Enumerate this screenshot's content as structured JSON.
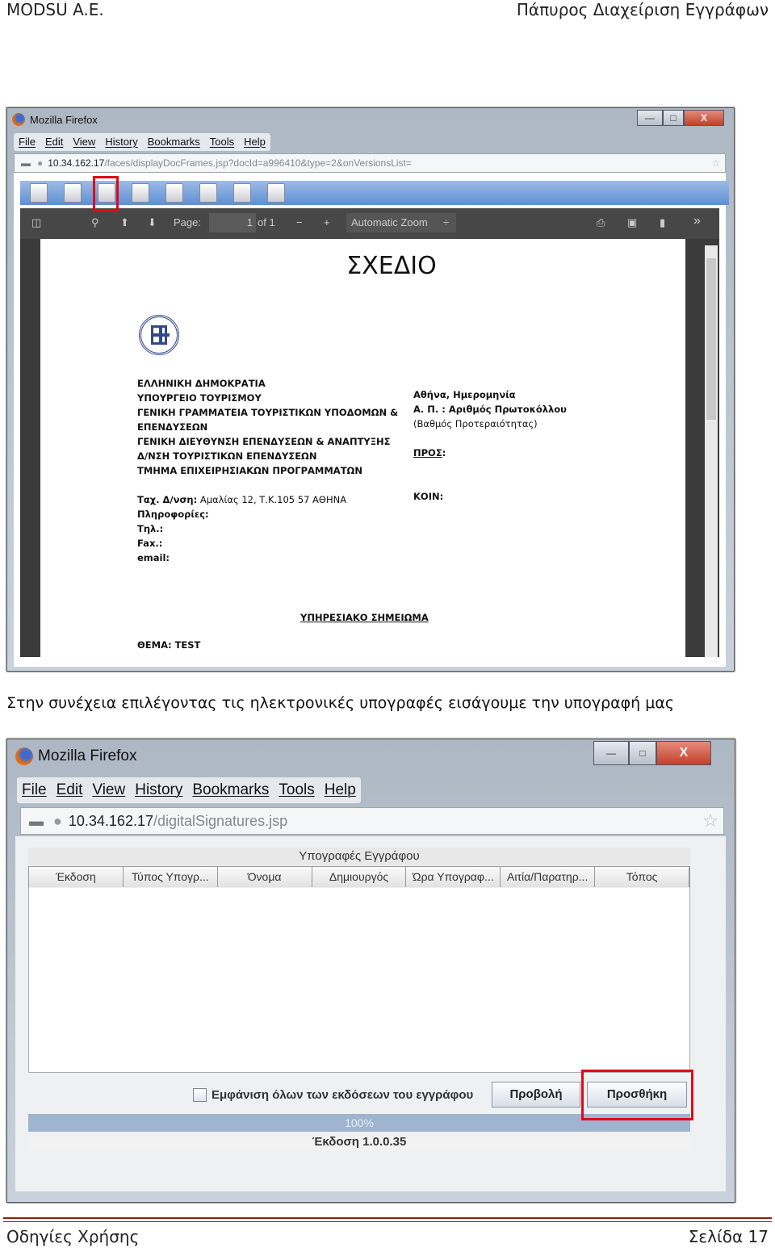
{
  "header": {
    "left": "MODSU A.E.",
    "right": "Πάπυρος Διαχείριση Εγγράφων"
  },
  "screenshot1": {
    "window_title": "Mozilla Firefox",
    "window_controls": {
      "minimize": "—",
      "maximize": "□",
      "close": "X"
    },
    "menu": [
      "File",
      "Edit",
      "View",
      "History",
      "Bookmarks",
      "Tools",
      "Help"
    ],
    "url": {
      "host": "10.34.162.17",
      "path": "/faces/displayDocFrames.jsp?docId=a996410&type=2&onVersionsList="
    },
    "app_toolbar_icons": [
      "document-icon",
      "eye-icon",
      "signature-icon",
      "add-document-icon",
      "add-attachment-icon",
      "page-icon",
      "edit-icon",
      "check-icon"
    ],
    "highlighted_icon": "signature-icon",
    "pdf_toolbar": {
      "page_label": "Page:",
      "page_value": "1",
      "page_of": "of 1",
      "minus": "−",
      "plus": "+",
      "zoom": "Automatic Zoom",
      "zoom_arrow": "÷",
      "more": "»"
    },
    "document": {
      "title": "ΣΧΕΔΙΟ",
      "org_lines": [
        "ΕΛΛΗΝΙΚΗ ΔΗΜΟΚΡΑΤΙΑ",
        "ΥΠΟΥΡΓΕΙΟ ΤΟΥΡΙΣΜΟΥ",
        "ΓΕΝΙΚΗ ΓΡΑΜΜΑΤΕΙΑ ΤΟΥΡΙΣΤΙΚΩΝ ΥΠΟΔΟΜΩΝ &",
        "ΕΠΕΝΔΥΣΕΩΝ",
        "ΓΕΝΙΚΗ ΔΙΕΥΘΥΝΣΗ ΕΠΕΝΔΥΣΕΩΝ & ΑΝΑΠΤΥΞΗΣ",
        "Δ/ΝΣΗ ΤΟΥΡΙΣΤΙΚΩΝ ΕΠΕΝΔΥΣΕΩΝ",
        "ΤΜΗΜΑ ΕΠΙΧΕΙΡΗΣΙΑΚΩΝ ΠΡΟΓΡΑΜΜΑΤΩΝ"
      ],
      "address_label": "Ταχ. Δ/νση:",
      "address_value": " Αμαλίας 12, Τ.Κ.105 57 ΑΘΗΝΑ",
      "contact_labels": [
        "Πληροφορίες:",
        "Τηλ.:",
        "Fax.:",
        "email:"
      ],
      "date": "Αθήνα,  Ημερομηνία",
      "protocol": "Α. Π. :  Αριθμός Πρωτοκόλλου",
      "priority": "(Βαθμός Προτεραιότητας)",
      "to": "ΠΡΟΣ",
      "to_colon": ":",
      "cc": "ΚΟΙΝ:",
      "memo": "ΥΠΗΡΕΣΙΑΚΟ ΣΗΜΕΙΩΜΑ",
      "subject": "ΘΕΜΑ: TEST"
    }
  },
  "caption": "Στην συνέχεια επιλέγοντας τις ηλεκτρονικές υπογραφές εισάγουμε την υπογραφή μας",
  "screenshot2": {
    "window_title": "Mozilla Firefox",
    "window_controls": {
      "minimize": "—",
      "maximize": "□",
      "close": "X"
    },
    "menu": [
      "File",
      "Edit",
      "View",
      "History",
      "Bookmarks",
      "Tools",
      "Help"
    ],
    "url": {
      "host": "10.34.162.17",
      "path": "/digitalSignatures.jsp"
    },
    "table_title": "Υπογραφές Εγγράφου",
    "columns": [
      "Έκδοση",
      "Τύπος Υπογρ...",
      "Όνομα",
      "Δημιουργός",
      "Ώρα Υπογραφ...",
      "Αιτία/Παρατηρ...",
      "Τόπος"
    ],
    "rows": [],
    "checkbox_label": "Εμφάνιση όλων των εκδόσεων του εγγράφου",
    "checkbox_checked": false,
    "view_button": "Προβολή",
    "add_button": "Προσθήκη",
    "progress_text": "100%",
    "progress_percent": 100,
    "version": "Έκδοση 1.0.0.35"
  },
  "footer": {
    "left": "Οδηγίες Χρήσης",
    "right": "Σελίδα 17"
  },
  "colors": {
    "highlight": "#e00a14",
    "footer_rule": "#8b1a1a",
    "toolbar_blue": "#5f8fd3"
  }
}
